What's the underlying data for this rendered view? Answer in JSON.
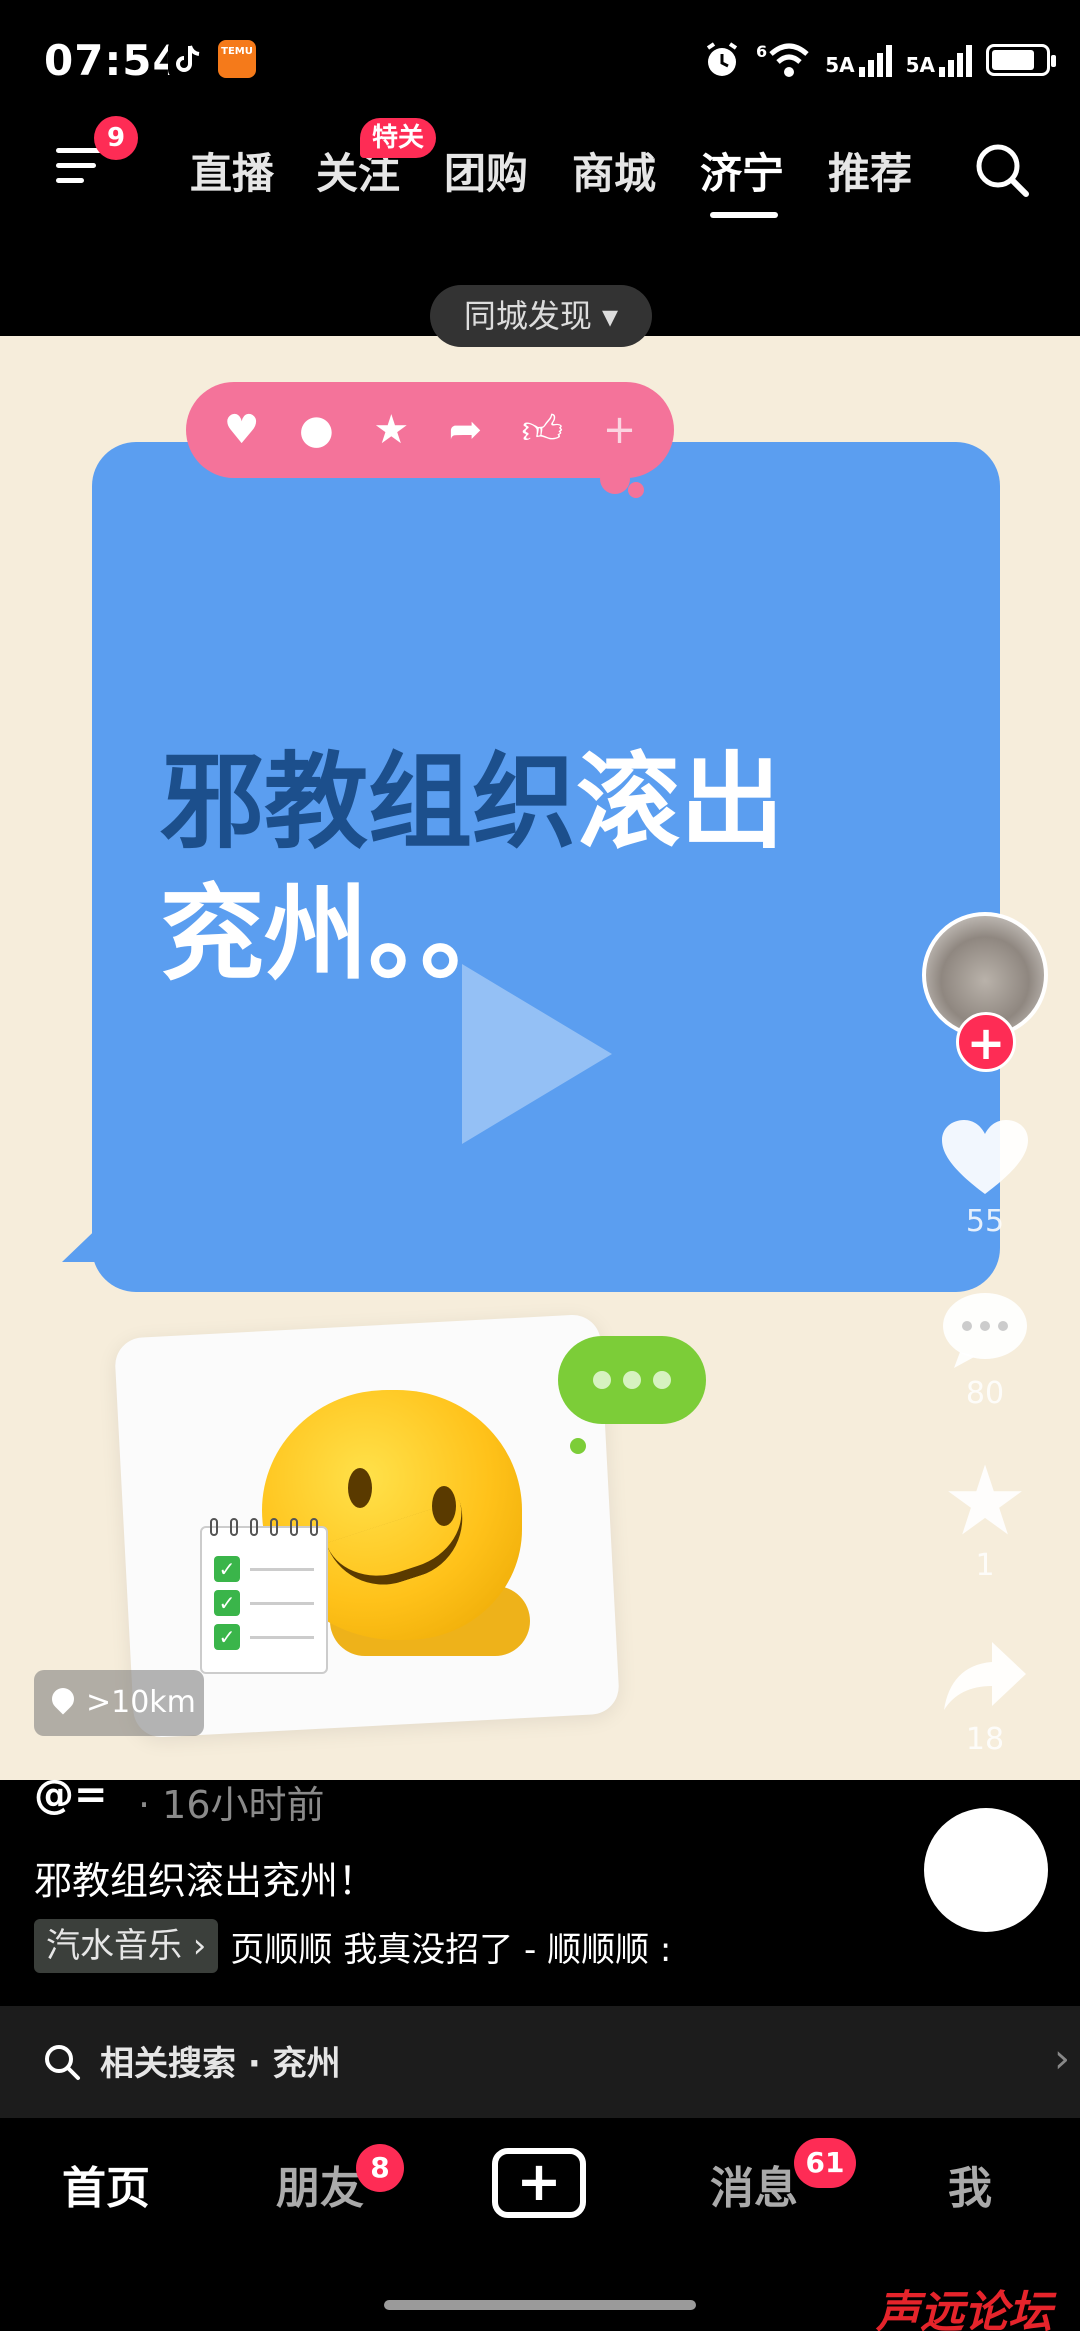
{
  "status_bar": {
    "time": "07:54",
    "app_icons": [
      "tiktok-icon",
      "temu-icon"
    ],
    "temu_label": "TEMU",
    "net1": "5A",
    "net2": "5A",
    "wifi_label": "6"
  },
  "top_nav": {
    "menu_badge": "9",
    "tabs": [
      "直播",
      "关注",
      "团购",
      "商城",
      "济宁",
      "推荐"
    ],
    "active_tab": "济宁",
    "follow_badge": "特关",
    "city_filter": "同城发现 ▾"
  },
  "video": {
    "headline_dark": "邪教组织",
    "headline_white1": "滚出",
    "headline_white2": "兖州。。",
    "reaction_icons": [
      "heart-icon",
      "comment-icon",
      "star-icon",
      "share-icon",
      "thumbs-up-icon",
      "plus-icon"
    ],
    "location": ">10km",
    "colors": {
      "background": "#f6eddb",
      "bubble": "#5b9ef0",
      "reaction_bar": "#f4739a",
      "green_bubble": "#7ccd38"
    }
  },
  "actions": {
    "likes": "55",
    "comments": "80",
    "favorites": "1",
    "shares": "18"
  },
  "post": {
    "author": "@=",
    "time_ago": "· 16小时前",
    "caption": "邪教组织滚出兖州！",
    "music_chip": "汽水音乐 ›",
    "music_text": "页顺顺  我真没招了 - 顺顺顺  :"
  },
  "related_search": {
    "label": "相关搜索 · 兖州",
    "arrow": "›"
  },
  "bottom_nav": {
    "tabs": [
      "首页",
      "朋友",
      "消息",
      "我"
    ],
    "create": "+",
    "friends_badge": "8",
    "messages_badge": "61",
    "active": "首页"
  },
  "watermark": "声远论坛",
  "accent": "#fe2c55"
}
